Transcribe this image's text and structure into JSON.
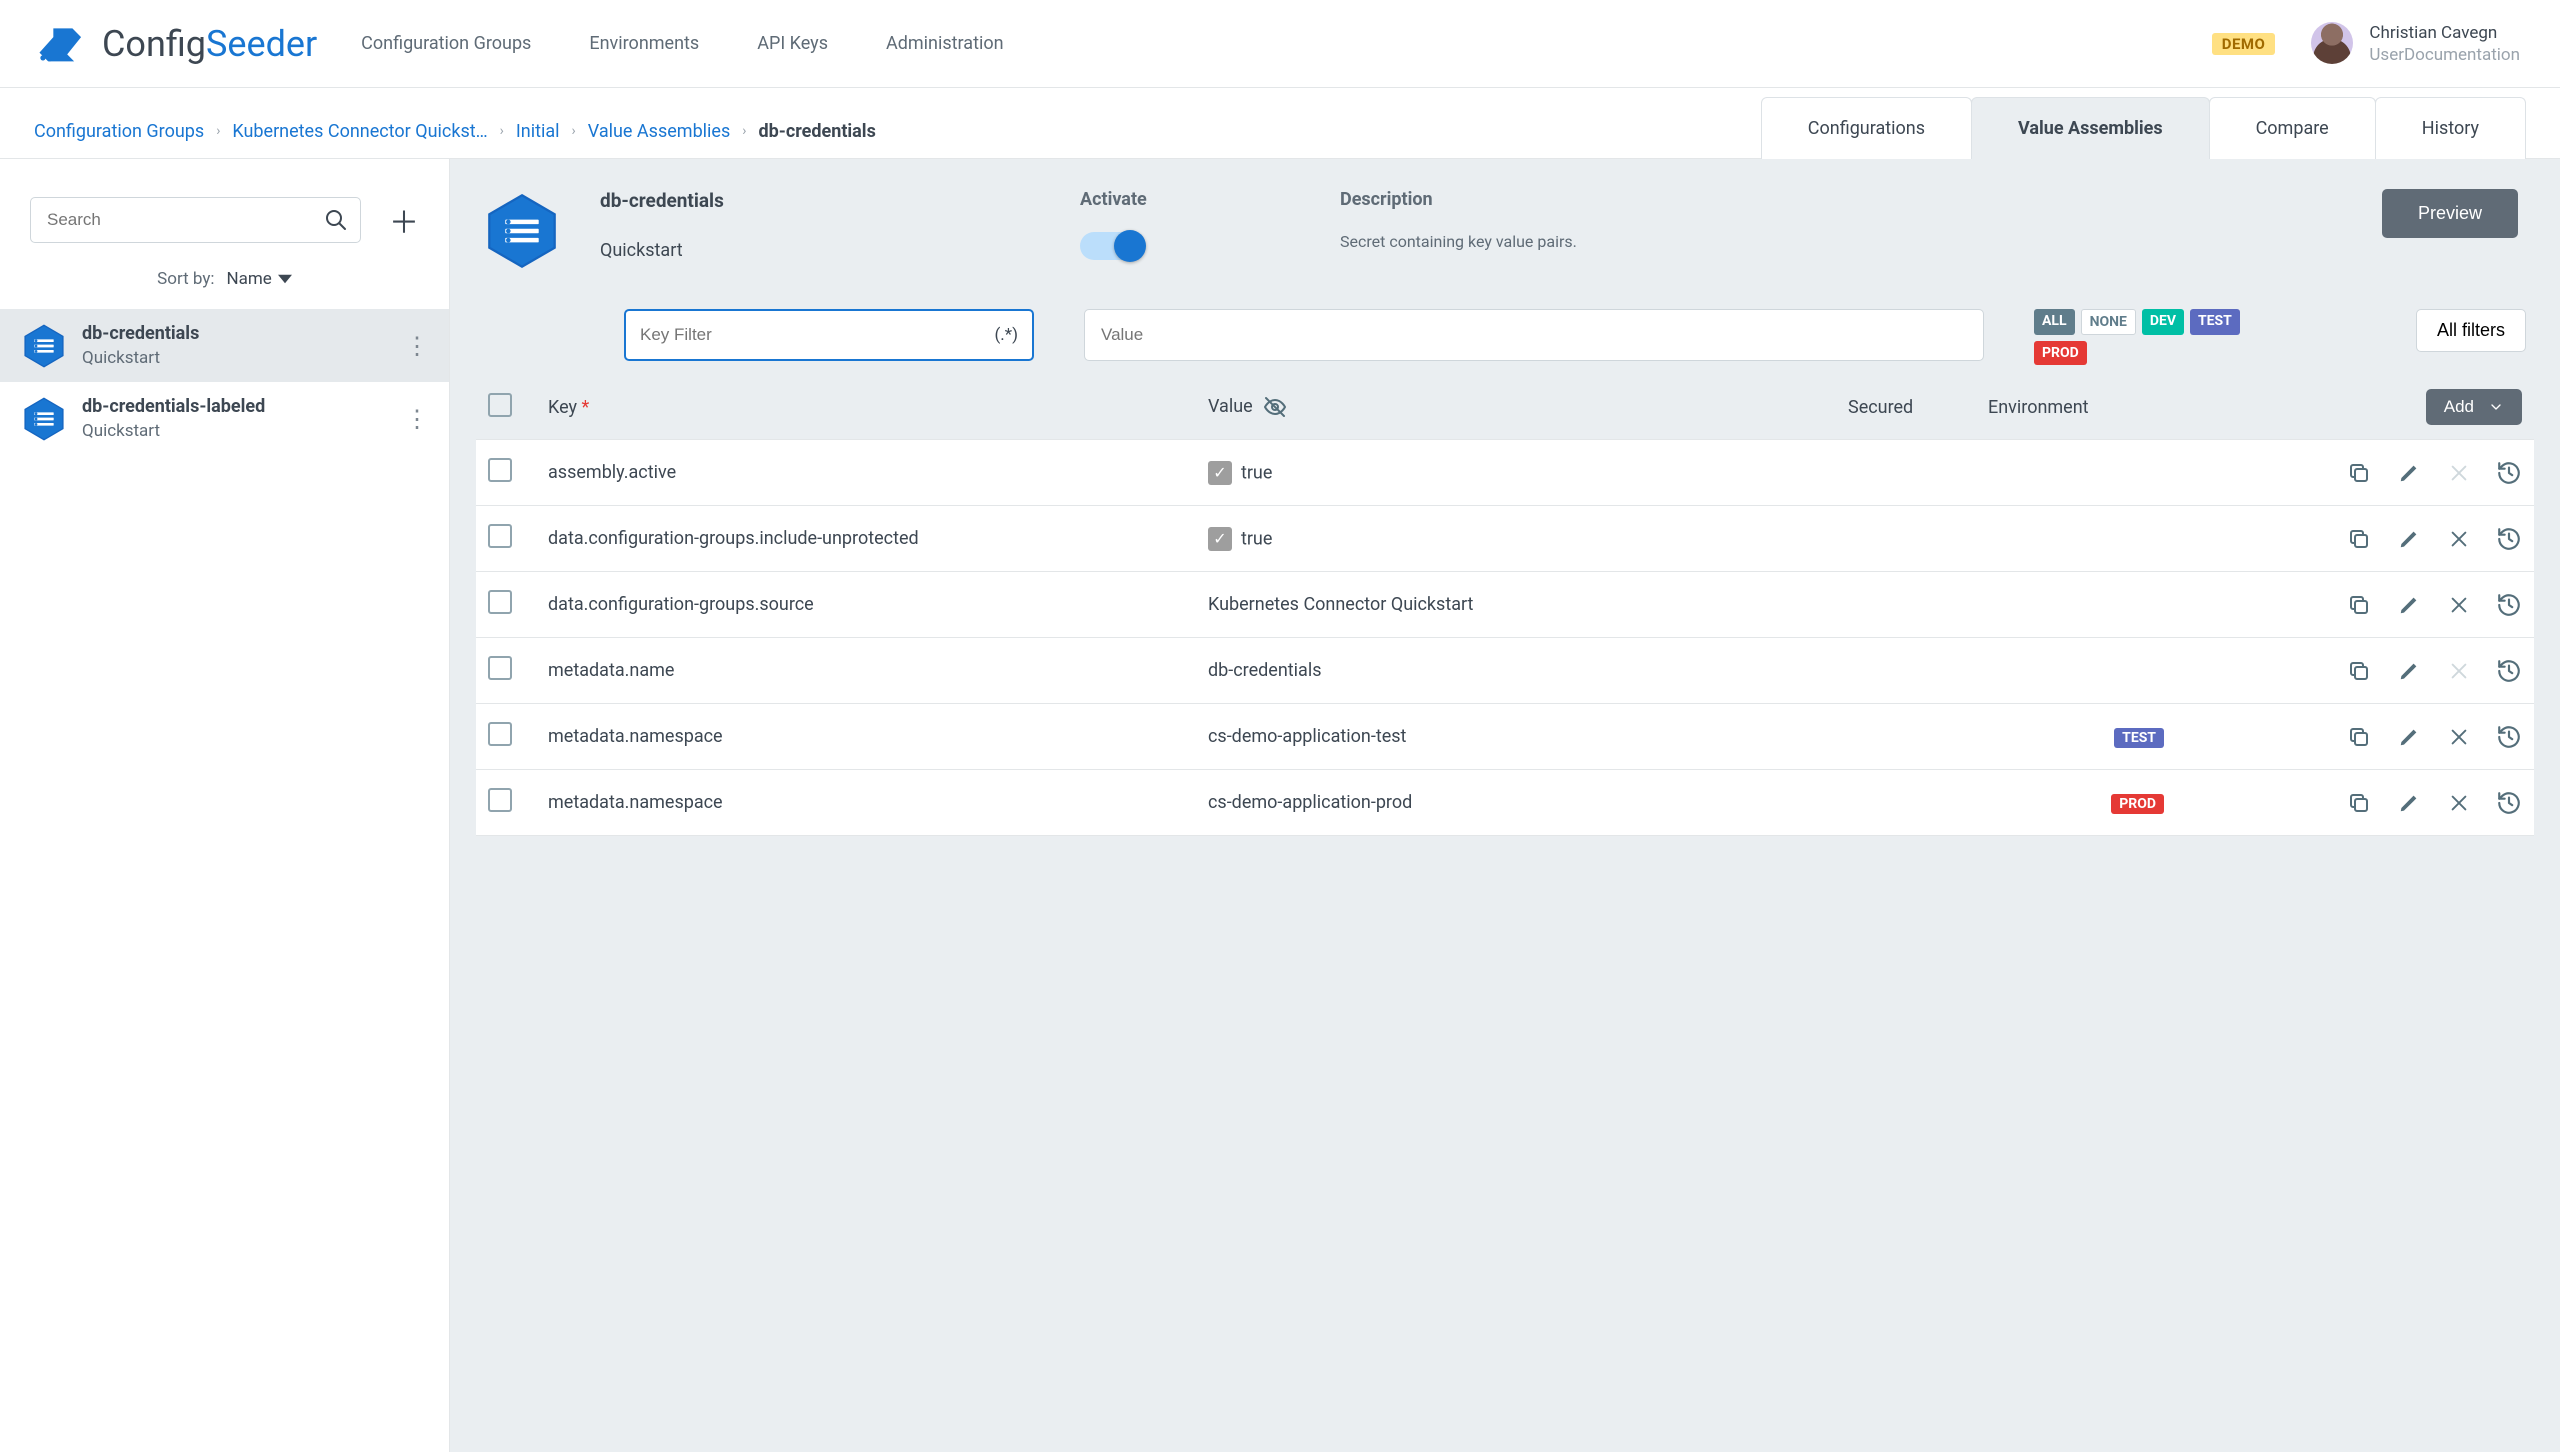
{
  "brand": {
    "config": "Config",
    "seeder": "Seeder"
  },
  "nav": {
    "groups": "Configuration Groups",
    "envs": "Environments",
    "apikeys": "API Keys",
    "admin": "Administration"
  },
  "demo_badge": "DEMO",
  "user": {
    "name": "Christian Cavegn",
    "org": "UserDocumentation"
  },
  "crumbs": {
    "c0": "Configuration Groups",
    "c1": "Kubernetes Connector Quickst…",
    "c2": "Initial",
    "c3": "Value Assemblies",
    "c4": "db-credentials",
    "sep": "›"
  },
  "tabs": {
    "configs": "Configurations",
    "assemblies": "Value Assemblies",
    "compare": "Compare",
    "history": "History"
  },
  "side": {
    "search_placeholder": "Search",
    "sort_label": "Sort by:",
    "sort_value": "Name",
    "items": [
      {
        "title": "db-credentials",
        "sub": "Quickstart"
      },
      {
        "title": "db-credentials-labeled",
        "sub": "Quickstart"
      }
    ]
  },
  "head": {
    "title": "db-credentials",
    "sub": "Quickstart",
    "activate_label": "Activate",
    "desc_label": "Description",
    "desc_val": "Secret containing key value pairs.",
    "preview": "Preview"
  },
  "tabletop": {
    "key_ph": "Key Filter",
    "regex": "(.*)",
    "value_ph": "Value",
    "chips": {
      "all": "ALL",
      "none": "NONE",
      "dev": "DEV",
      "test": "TEST",
      "prod": "PROD"
    },
    "allfilters": "All filters"
  },
  "cols": {
    "key": "Key",
    "value": "Value",
    "secured": "Secured",
    "env": "Environment",
    "add": "Add"
  },
  "rows": [
    {
      "key": "assembly.active",
      "value": "true",
      "checkbox": true,
      "env": null,
      "del": false
    },
    {
      "key": "data.configuration-groups.include-unprotected",
      "value": "true",
      "checkbox": true,
      "env": null,
      "del": true
    },
    {
      "key": "data.configuration-groups.source",
      "value": "Kubernetes Connector Quickstart",
      "checkbox": false,
      "env": null,
      "del": true
    },
    {
      "key": "metadata.name",
      "value": "db-credentials",
      "checkbox": false,
      "env": null,
      "del": false
    },
    {
      "key": "metadata.namespace",
      "value": "cs-demo-application-test",
      "checkbox": false,
      "env": "TEST",
      "del": true
    },
    {
      "key": "metadata.namespace",
      "value": "cs-demo-application-prod",
      "checkbox": false,
      "env": "PROD",
      "del": true
    }
  ]
}
